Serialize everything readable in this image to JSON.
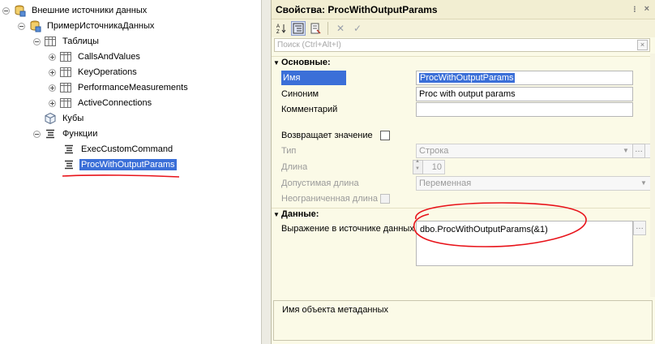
{
  "tree": {
    "root": "Внешние источники данных",
    "source": "ПримерИсточникаДанных",
    "tables_group": "Таблицы",
    "tables": [
      "CallsAndValues",
      "KeyOperations",
      "PerformanceMeasurements",
      "ActiveConnections"
    ],
    "cubes": "Кубы",
    "functions_group": "Функции",
    "functions": [
      "ExecCustomCommand",
      "ProcWithOutputParams"
    ]
  },
  "props": {
    "title": "Свойства: ProcWithOutputParams",
    "search_placeholder": "Поиск (Ctrl+Alt+I)",
    "sections": {
      "main": "Основные:",
      "data": "Данные:"
    },
    "fields": {
      "name_label": "Имя",
      "name_value": "ProcWithOutputParams",
      "synonym_label": "Синоним",
      "synonym_value": "Proc with output params",
      "comment_label": "Комментарий",
      "comment_value": "",
      "returns_label": "Возвращает значение",
      "type_label": "Тип",
      "type_value": "Строка",
      "length_label": "Длина",
      "length_value": "10",
      "allowed_length_label": "Допустимая длина",
      "allowed_length_value": "Переменная",
      "unlimited_label": "Неограниченная длина",
      "expr_label": "Выражение в источнике данных",
      "expr_value": "dbo.ProcWithOutputParams(&1)"
    },
    "description": "Имя объекта метаданных"
  },
  "colors": {
    "selection": "#3b6fd8",
    "panel_bg": "#fbfae7",
    "annotation": "#e8131a"
  }
}
